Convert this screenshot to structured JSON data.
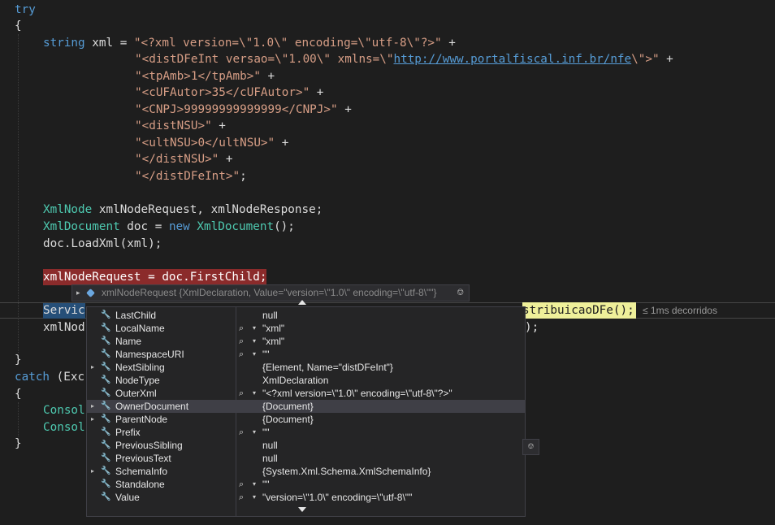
{
  "code": {
    "try_kw": "try",
    "brace_open": "{",
    "string_kw": "string",
    "xml_decl_rest": " xml = ",
    "s1": "\"<?xml version=\\\"1.0\\\" encoding=\\\"utf-8\\\"?>\"",
    "plus": " +",
    "s2a": "\"<distDFeInt versao=\\\"1.00\\\" xmlns=\\\"",
    "s2_link": "http://www.portalfiscal.inf.br/nfe",
    "s2b": "\\\">\"",
    "s3": "\"<tpAmb>1</tpAmb>\"",
    "s4": "\"<cUFAutor>35</cUFAutor>\"",
    "s5": "\"<CNPJ>99999999999999</CNPJ>\"",
    "s6": "\"<distNSU>\"",
    "s7": "\"<ultNSU>0</ultNSU>\"",
    "s8": "\"</distNSU>\"",
    "s9": "\"</distDFeInt>\"",
    "semi": ";",
    "xmlnode_type": "XmlNode",
    "xmlnode_rest": " xmlNodeRequest, xmlNodeResponse;",
    "xmldoc_type": "XmlDocument",
    "doc_decl": " doc = ",
    "new_kw": "new",
    "xmldoc_type2": "XmlDocument",
    "ctor_end": "();",
    "loadxml": "doc.LoadXml(xml);",
    "bp_line": "xmlNodeRequest = doc.FirstChild;",
    "cur_line_start": "Servic",
    "cur_line_end": "stribuicaoDFe();",
    "elapsed": "≤ 1ms decorridos",
    "next_line_start": "xmlNod",
    "next_line_end": ");",
    "brace_close": "}",
    "catch_kw": "catch",
    "catch_rest": " (Exc",
    "console1": "Consol",
    "console2": "Consol"
  },
  "datatip": {
    "header": "xmlNodeRequest  {XmlDeclaration, Value=\"version=\\\"1.0\\\" encoding=\\\"utf-8\\\"\"}",
    "rows": [
      {
        "name": "LastChild",
        "value": "null",
        "expandable": false,
        "mag": false
      },
      {
        "name": "LocalName",
        "value": "\"xml\"",
        "expandable": false,
        "mag": true
      },
      {
        "name": "Name",
        "value": "\"xml\"",
        "expandable": false,
        "mag": true
      },
      {
        "name": "NamespaceURI",
        "value": "\"\"",
        "expandable": false,
        "mag": true
      },
      {
        "name": "NextSibling",
        "value": "{Element, Name=\"distDFeInt\"}",
        "expandable": true,
        "mag": false
      },
      {
        "name": "NodeType",
        "value": "XmlDeclaration",
        "expandable": false,
        "mag": false
      },
      {
        "name": "OuterXml",
        "value": "\"<?xml version=\\\"1.0\\\" encoding=\\\"utf-8\\\"?>\"",
        "expandable": false,
        "mag": true
      },
      {
        "name": "OwnerDocument",
        "value": "{Document}",
        "expandable": true,
        "mag": false
      },
      {
        "name": "ParentNode",
        "value": "{Document}",
        "expandable": true,
        "mag": false
      },
      {
        "name": "Prefix",
        "value": "\"\"",
        "expandable": false,
        "mag": true
      },
      {
        "name": "PreviousSibling",
        "value": "null",
        "expandable": false,
        "mag": false
      },
      {
        "name": "PreviousText",
        "value": "null",
        "expandable": false,
        "mag": false
      },
      {
        "name": "SchemaInfo",
        "value": "{System.Xml.Schema.XmlSchemaInfo}",
        "expandable": true,
        "mag": false
      },
      {
        "name": "Standalone",
        "value": "\"\"",
        "expandable": false,
        "mag": true
      },
      {
        "name": "Value",
        "value": "\"version=\\\"1.0\\\" encoding=\\\"utf-8\\\"\"",
        "expandable": false,
        "mag": true
      }
    ],
    "selected_row": "OwnerDocument"
  },
  "colors": {
    "editor_bg": "#1e1e1e",
    "keyword": "#569cd6",
    "type": "#4ec9b0",
    "string": "#d69d85",
    "breakpoint": "#8b2b2b",
    "current_stmt": "#eff09a"
  },
  "icons": {
    "property": "wrench-icon",
    "search": "magnifier-icon",
    "expander": "triangle-right-icon",
    "pin": "pin-icon",
    "object": "cube-icon"
  }
}
